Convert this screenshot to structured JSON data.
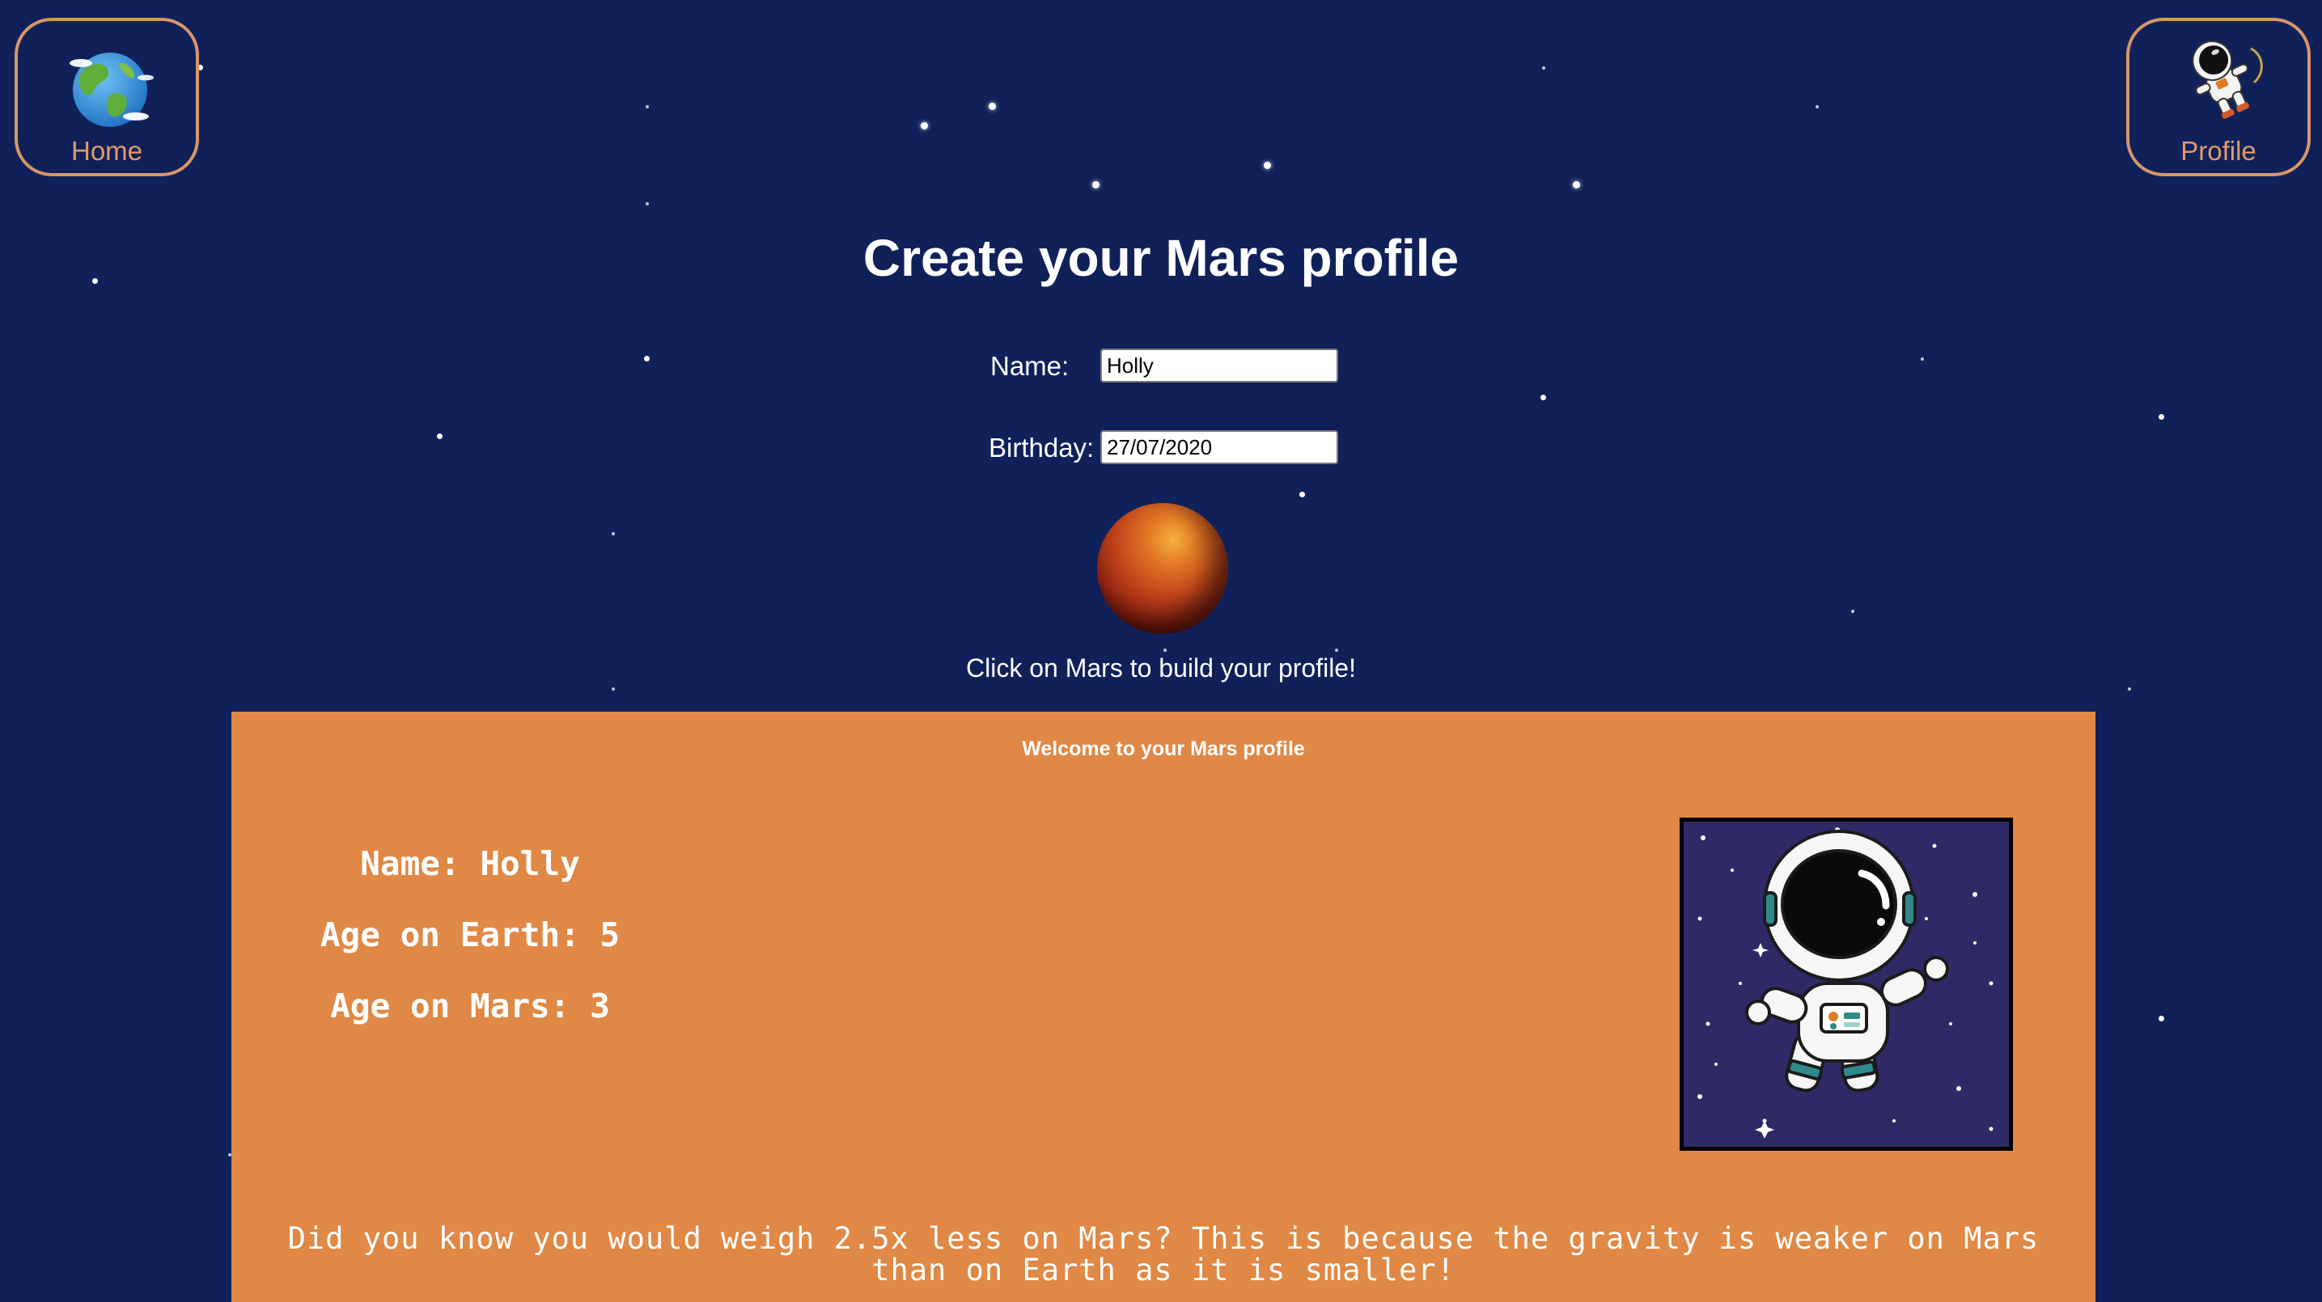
{
  "nav": {
    "home_label": "Home",
    "profile_label": "Profile",
    "home_icon": "earth-globe-icon",
    "profile_icon": "astronaut-icon"
  },
  "page_title": "Create your Mars profile",
  "form": {
    "name_label": "Name:",
    "name_value": "Holly",
    "birthday_label": "Birthday:",
    "birthday_value": "27/07/2020"
  },
  "mars_hint": "Click on Mars to build your profile!",
  "profile_card": {
    "title": "Welcome to your Mars profile",
    "name_line": "Name: Holly",
    "earth_age_line": "Age on Earth: 5",
    "mars_age_line": "Age on Mars: 3",
    "fact": "Did you know you would weigh 2.5x less on Mars? This is because the gravity is weaker on Mars than on Earth as it is smaller!",
    "image_icon": "astronaut-in-space-illustration"
  },
  "colors": {
    "background": "#10215a",
    "panel": "#e08845",
    "nav_border": "#d89668",
    "nav_text": "#e29a68"
  }
}
